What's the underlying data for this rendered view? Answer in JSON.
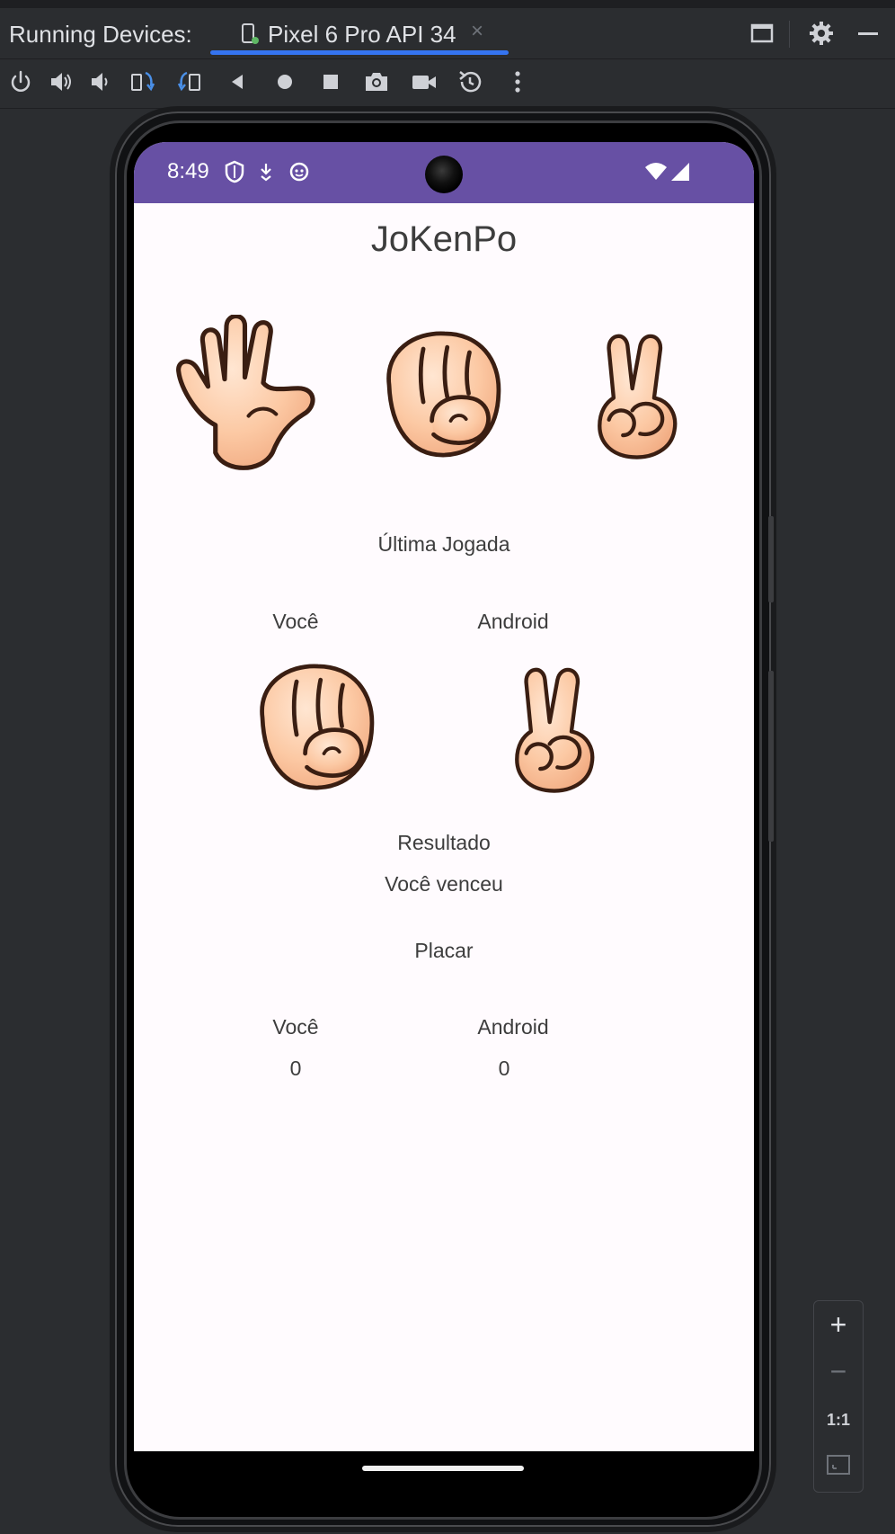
{
  "ide": {
    "panel_title": "Running Devices:",
    "tab_label": "Pixel 6 Pro API 34",
    "tab_close": "×",
    "header_icons": [
      "restore-window-icon",
      "gear-icon",
      "minimize-icon"
    ],
    "toolbar_icons": [
      "power-icon",
      "volume-up-icon",
      "volume-down-icon",
      "rotate-left-icon",
      "rotate-right-icon",
      "back-icon",
      "home-icon",
      "overview-icon",
      "camera-icon",
      "video-icon",
      "snapshot-icon",
      "more-icon"
    ],
    "zoom": {
      "plus": "+",
      "minus": "−",
      "actual": "1:1"
    },
    "accent": "#3574f0"
  },
  "device": {
    "status_time": "8:49",
    "status_icons": [
      "shield-icon",
      "download-icon",
      "face-icon",
      "wifi-icon",
      "signal-icon"
    ],
    "status_color": "#6750a4"
  },
  "app": {
    "title": "JoKenPo",
    "choices": [
      "paper-hand-icon",
      "rock-hand-icon",
      "scissors-hand-icon"
    ],
    "last_play_label": "Última Jogada",
    "you_label": "Você",
    "android_label": "Android",
    "you_choice": "rock-hand-icon",
    "android_choice": "scissors-hand-icon",
    "result_label": "Resultado",
    "result_value": "Você venceu",
    "score_label": "Placar",
    "score_you_label": "Você",
    "score_android_label": "Android",
    "score_you": "0",
    "score_android": "0"
  }
}
